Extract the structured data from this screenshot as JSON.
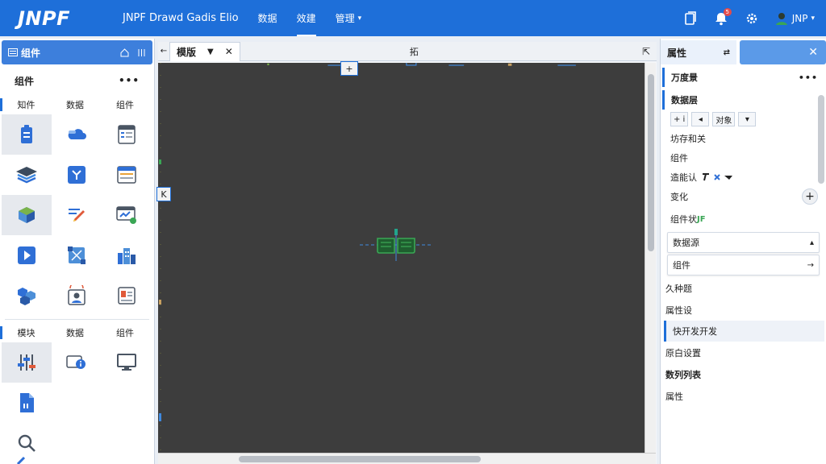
{
  "header": {
    "logo": "JNPF",
    "title": "JNPF Drawd Gadis Elio",
    "nav": [
      {
        "label": "数据",
        "active": false
      },
      {
        "label": "效建",
        "active": true
      },
      {
        "label": "管理",
        "active": false,
        "caret": "▾"
      }
    ],
    "notification_count": "5",
    "user_name": "JNP",
    "user_caret": "▾"
  },
  "left_panel": {
    "title": "组件",
    "subtitle": "组件",
    "more": "•••",
    "categories_top": [
      "知件",
      "数据",
      "组件"
    ],
    "categories_bottom": [
      "模块",
      "数据",
      "组件"
    ],
    "icons_top": [
      "clipboard-icon",
      "cloud-icon",
      "list-form-icon",
      "layers-icon",
      "down-arrow-box-icon",
      "table-icon",
      "cube-icon",
      "edit-icon",
      "chart-board-icon",
      "play-icon",
      "expand-box-icon",
      "building-icon",
      "hex-cluster-icon",
      "contact-icon",
      "report-icon"
    ],
    "icons_bottom": [
      "sliders-icon",
      "info-screen-icon",
      "monitor-icon",
      "file-icon",
      "",
      "",
      "magnify-icon"
    ]
  },
  "center": {
    "tab_label": "模版",
    "tab_dropdown": "▼",
    "tab_close": "✕",
    "back": "←",
    "mid_label": "拓",
    "right_icon": "⇱",
    "marker_top": "+",
    "marker_left": "K"
  },
  "right_panel": {
    "tab_title": "属性",
    "pin": "⇄",
    "close": "✕",
    "section1": "万度景",
    "more": "•••",
    "section2": "数据层",
    "buttons": [
      "+ i",
      "◂",
      "对象",
      "▾"
    ],
    "rows": [
      "坊存和关",
      "组件",
      "造能认",
      "变化"
    ],
    "add": "+",
    "status_row": "组件状",
    "status_tag": "JF",
    "cards": [
      {
        "label": "数据源",
        "arrow": "▴"
      },
      {
        "label": "组件",
        "arrow": "→"
      }
    ],
    "items": [
      "久种题",
      "属性设"
    ],
    "highlight_item": "快开发开发",
    "items2": [
      "原白设置",
      "数列列表",
      "属性"
    ]
  },
  "colors": {
    "header_blue": "#1e6fd9",
    "canvas": "#3d3d3d",
    "accent": "#1e6fd9"
  }
}
